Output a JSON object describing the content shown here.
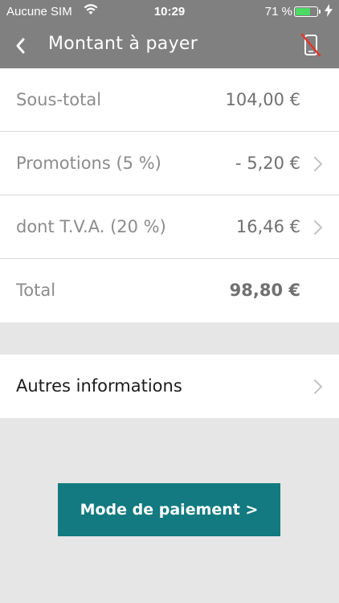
{
  "status_bar": {
    "carrier": "Aucune SIM",
    "time": "10:29",
    "battery_percent": "71 %",
    "battery_level": 0.71,
    "wifi_icon": "wifi-icon",
    "battery_color": "#4cd964"
  },
  "nav": {
    "title": "Montant à payer",
    "back_icon": "chevron-left-icon",
    "right_icon": "phone-disabled-icon",
    "background": "#808080"
  },
  "summary": {
    "rows": [
      {
        "label": "Sous-total",
        "value": "104,00 €"
      },
      {
        "label": "Promotions (5 %)",
        "value": "- 5,20 €"
      },
      {
        "label": "dont T.V.A. (20 %)",
        "value": "16,46 €"
      },
      {
        "label": "Total",
        "value": "98,80 €"
      }
    ]
  },
  "other": {
    "label": "Autres informations"
  },
  "payment_button": {
    "label": "Mode de paiement  >",
    "color": "#127a80"
  }
}
